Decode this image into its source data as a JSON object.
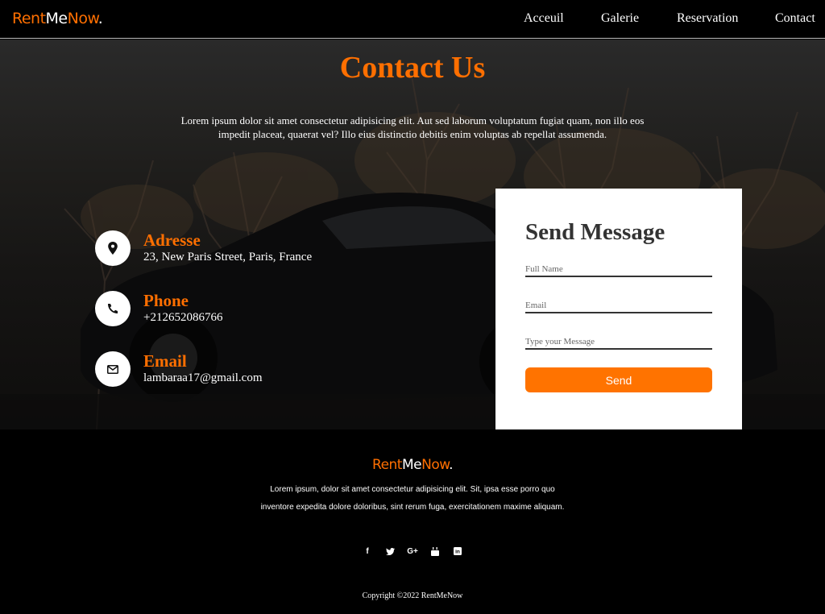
{
  "brand": {
    "part1": "Rent",
    "part2": "Me",
    "part3": "Now",
    "dot": "."
  },
  "nav": {
    "items": [
      "Acceuil",
      "Galerie",
      "Reservation",
      "Contact"
    ]
  },
  "hero": {
    "title": "Contact Us",
    "text": "Lorem ipsum dolor sit amet consectetur adipisicing elit. Aut sed laborum voluptatum fugiat quam, non illo eos impedit placeat, quaerat vel? Illo eius distinctio debitis enim voluptas ab repellat assumenda."
  },
  "contact_info": [
    {
      "label": "Adresse",
      "value": "23, New Paris Street, Paris, France",
      "icon": "map-pin-icon"
    },
    {
      "label": "Phone",
      "value": "+212652086766",
      "icon": "phone-icon"
    },
    {
      "label": "Email",
      "value": "lambaraa17@gmail.com",
      "icon": "envelope-icon"
    }
  ],
  "form": {
    "title": "Send Message",
    "name_placeholder": "Full Name",
    "email_placeholder": "Email",
    "message_placeholder": "Type your Message",
    "send_label": "Send"
  },
  "footer": {
    "text": "Lorem ipsum, dolor sit amet consectetur adipisicing elit. Sit, ipsa esse porro quo inventore expedita dolore doloribus, sint rerum fuga, exercitationem maxime aliquam.",
    "socials": [
      {
        "icon": "facebook-icon",
        "glyph": "f"
      },
      {
        "icon": "twitter-icon",
        "glyph": "t"
      },
      {
        "icon": "google-plus-icon",
        "glyph": "G+"
      },
      {
        "icon": "youtube-icon",
        "glyph": "▶"
      },
      {
        "icon": "linkedin-icon",
        "glyph": "in"
      }
    ],
    "copyright": "Copyright ©2022 RentMeNow"
  },
  "colors": {
    "accent": "#ff6f00",
    "button": "#ff7300",
    "background": "#000000"
  }
}
